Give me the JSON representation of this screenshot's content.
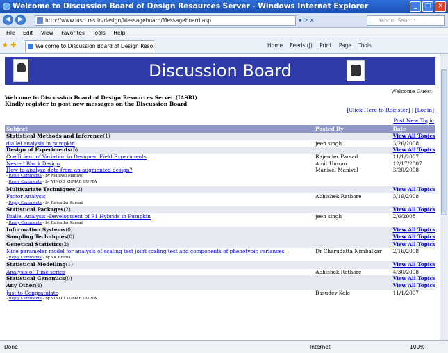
{
  "window": {
    "title": "Welcome to Discussion Board of Design Resources Server - Windows Internet Explorer",
    "min": "_",
    "max": "□",
    "close": "✕"
  },
  "address": {
    "url": "http://www.iasri.res.in/design/Messageboard/Messageboard.asp",
    "search_placeholder": "Yahoo! Search"
  },
  "menu": [
    "File",
    "Edit",
    "View",
    "Favorites",
    "Tools",
    "Help"
  ],
  "tab": {
    "label": "Welcome to Discussion Board of Design Reso..."
  },
  "commands": [
    "Home",
    "Feeds (J)",
    "Print",
    "Page",
    "Tools"
  ],
  "banner": {
    "title": "Discussion Board"
  },
  "welcome_guest": "Welcome Guest!",
  "intro": {
    "line1": "Welcome to Discussion Board of Design Resources Server (IASRI)",
    "line2": "Kindly register to post new messages on the Discussion Board"
  },
  "reg": {
    "register": "[Click Here to Register]",
    "sep": " | ",
    "login": "[Login]"
  },
  "post_new": "Post New Topic",
  "table": {
    "headers": [
      "Subject",
      "Posted By",
      "Date"
    ],
    "view_all": "View All Topics",
    "reply_label": "Reply Comments",
    "rows": [
      {
        "type": "cat",
        "name": "Statistical Methods and Inference",
        "count": "(1)"
      },
      {
        "type": "topic",
        "subject": "diallel analysis in pumpkin",
        "by": "jeen singh",
        "date": "3/26/2008"
      },
      {
        "type": "cat",
        "name": "Design of Experiments",
        "count": "(5)"
      },
      {
        "type": "topic",
        "subject": "Coefficient of Variation in Designed Field Experiments",
        "by": "Rajender Parsad",
        "date": "11/1/2007"
      },
      {
        "type": "topic",
        "subject": "Nested Block Design",
        "by": "Amit Umrao",
        "date": "12/17/2007"
      },
      {
        "type": "topic",
        "subject": "How to analyze data from an augmented design?",
        "by": "Manivel Manivel",
        "date": "3/20/2008"
      },
      {
        "type": "reply",
        "by": "- by Manivel Manivel"
      },
      {
        "type": "reply",
        "by": "- by VINOD KUMAR GUPTA"
      },
      {
        "type": "cat",
        "name": "Multivariate Techniques",
        "count": "(2)"
      },
      {
        "type": "topic",
        "subject": "Factor Analysis",
        "by": "Abhishek Rathore",
        "date": "3/19/2008"
      },
      {
        "type": "reply",
        "by": "- by Rajender Parsad"
      },
      {
        "type": "cat",
        "name": "Statistical Packages",
        "count": "(2)"
      },
      {
        "type": "topic",
        "subject": "Diallel Analysis -Development of F1 Hybrids in Pumpkin",
        "by": "jeen singh",
        "date": "2/6/2008"
      },
      {
        "type": "reply",
        "by": "- by Rajender Parsad"
      },
      {
        "type": "cat",
        "name": "Information Systems",
        "count": "(0)"
      },
      {
        "type": "cat",
        "name": "Sampling Techniques",
        "count": "(0)"
      },
      {
        "type": "cat",
        "name": "Genetical Statistics",
        "count": "(2)"
      },
      {
        "type": "topic",
        "subject": "Nine parameter model for analysis of scaling test joint scaling test and components of phenotypic variances",
        "by": "Dr Charudatta Nimbalkar",
        "date": "2/16/2008"
      },
      {
        "type": "reply",
        "by": "- by VK Bhatia"
      },
      {
        "type": "cat",
        "name": "Statistical Modelling",
        "count": "(1)"
      },
      {
        "type": "topic",
        "subject": "Analysis of Time series",
        "by": "Abhishek Rathore",
        "date": "4/30/2008"
      },
      {
        "type": "cat",
        "name": "Statistical Genomics",
        "count": "(0)"
      },
      {
        "type": "cat",
        "name": "Any Other",
        "count": "(4)"
      },
      {
        "type": "topic",
        "subject": "Just to Congratulate",
        "by": "Basudev Kole",
        "date": "11/1/2007"
      },
      {
        "type": "reply",
        "by": "- by VINOD KUMAR GUPTA"
      }
    ]
  },
  "status": {
    "left": "Done",
    "zone": "Internet",
    "zoom": "100%"
  },
  "colors": {
    "banner": "#2f3bab",
    "header": "#8f97c7",
    "category": "#e6e8f2",
    "link": "#0000cc"
  }
}
